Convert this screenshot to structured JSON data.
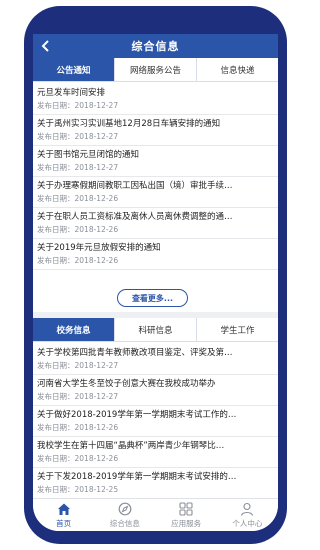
{
  "header": {
    "title": "综合信息",
    "back_icon": "chevron-left-icon"
  },
  "top_tabs": [
    {
      "label": "公告通知",
      "active": true
    },
    {
      "label": "网络服务公告",
      "active": false
    },
    {
      "label": "信息快递",
      "active": false
    }
  ],
  "notices": [
    {
      "title": "元旦发车时间安排",
      "date": "发布日期：2018-12-27"
    },
    {
      "title": "关于禹州实习实训基地12月28日车辆安排的通知",
      "date": "发布日期：2018-12-27"
    },
    {
      "title": "关于图书馆元旦闭馆的通知",
      "date": "发布日期：2018-12-27"
    },
    {
      "title": "关于办理寒假期间教职工因私出国（境）审批手续…",
      "date": "发布日期：2018-12-26"
    },
    {
      "title": "关于在职人员工资标准及离休人员离休费调整的通…",
      "date": "发布日期：2018-12-26"
    },
    {
      "title": "关于2019年元旦放假安排的通知",
      "date": "发布日期：2018-12-26"
    }
  ],
  "more_button": "查看更多...",
  "bottom_tabs": [
    {
      "label": "校务信息",
      "active": true
    },
    {
      "label": "科研信息",
      "active": false
    },
    {
      "label": "学生工作",
      "active": false
    }
  ],
  "affairs": [
    {
      "title": "关于学校第四批青年教师教改项目鉴定、评奖及第…",
      "date": "发布日期：2018-12-27"
    },
    {
      "title": "河南省大学生冬至饺子创意大赛在我校成功举办",
      "date": "发布日期：2018-12-27"
    },
    {
      "title": "关于做好2018-2019学年第一学期期末考试工作的…",
      "date": "发布日期：2018-12-26"
    },
    {
      "title": "我校学生在第十四届“晶典杯”两岸青少年钢琴比…",
      "date": "发布日期：2018-12-26"
    },
    {
      "title": "关于下发2018-2019学年第一学期期末考试安排的…",
      "date": "发布日期：2018-12-25"
    }
  ],
  "nav": [
    {
      "label": "首页",
      "icon": "home-icon",
      "active": true
    },
    {
      "label": "综合信息",
      "icon": "compass-icon",
      "active": false
    },
    {
      "label": "应用服务",
      "icon": "grid-icon",
      "active": false
    },
    {
      "label": "个人中心",
      "icon": "user-icon",
      "active": false
    }
  ],
  "colors": {
    "primary": "#2a55a8",
    "frame": "#1d2f7c",
    "muted": "#8a8f99"
  }
}
